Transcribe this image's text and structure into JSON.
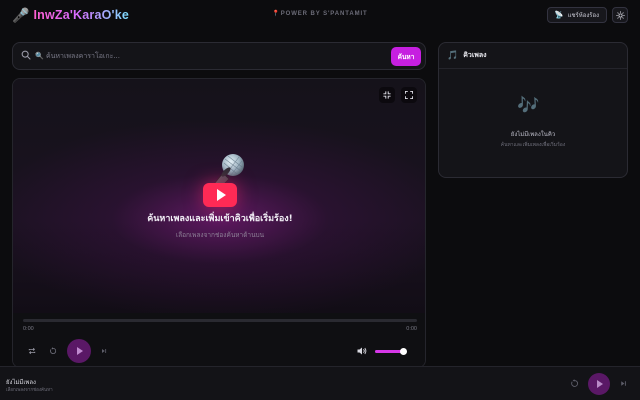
{
  "header": {
    "app_name": "InwZa'KaraO'ke",
    "powered_by": "POWER BY S'PANTAMIT",
    "room_button_label": "แชร์ห้องร้อง",
    "brand_icon": "microphone-icon",
    "theme_icon": "sun-icon"
  },
  "search": {
    "placeholder": "🔍 ค้นหาเพลงคาราโอเกะ...",
    "value": "",
    "button_label": "ค้นหา"
  },
  "player": {
    "empty_title": "ค้นหาเพลงและเพิ่มเข้าคิวเพื่อเริ่มร้อง!",
    "empty_subtitle": "เลือกเพลงจากช่องค้นหาด้านบน",
    "current_time": "0:00",
    "duration": "0:00",
    "progress_fraction": 0,
    "volume_fraction": 0.9,
    "icons": [
      "fullscreen-exit-icon",
      "fullscreen-icon",
      "repeat-icon",
      "replay-icon",
      "play-icon",
      "skip-next-icon",
      "volume-icon"
    ]
  },
  "queue": {
    "title": "คิวเพลง",
    "empty_title": "ยังไม่มีเพลงในคิว",
    "empty_subtitle": "ค้นหาและเพิ่มเพลงเพื่อเริ่มร้อง"
  },
  "now_playing": {
    "title": "ยังไม่มีเพลง",
    "subtitle": "เลือกเพลงจากช่องค้นหา"
  },
  "colors": {
    "accent": "#c61fe0",
    "background": "#0c0c0e",
    "play_button": "#5a1866",
    "youtube_red": "#ff2a55"
  }
}
